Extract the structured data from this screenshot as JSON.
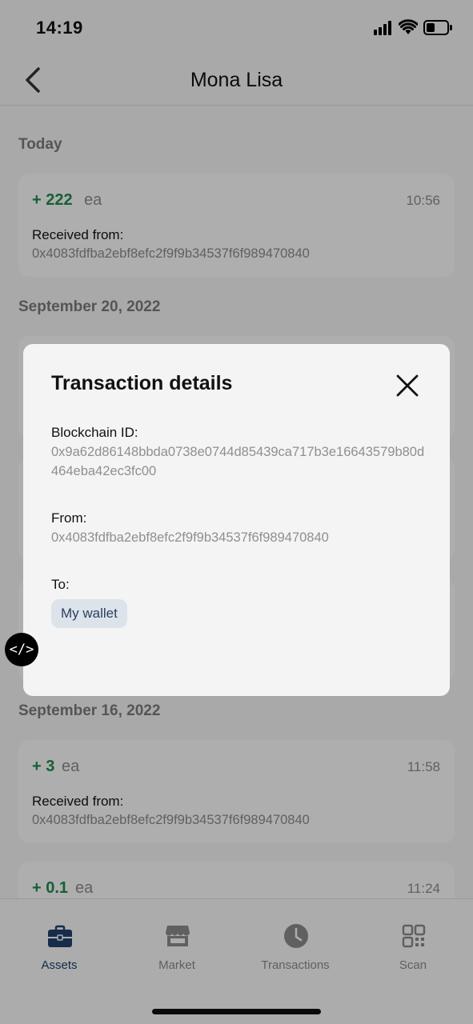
{
  "status_bar": {
    "time": "14:19"
  },
  "header": {
    "title": "Mona Lisa"
  },
  "sections": [
    {
      "title": "Today"
    },
    {
      "title": "September 20, 2022"
    },
    {
      "title": "September 16, 2022"
    }
  ],
  "transactions": [
    {
      "amount": "+ 222",
      "unit": "ea",
      "time": "10:56",
      "label": "Received from:",
      "address": "0x4083fdfba2ebf8efc2f9f9b34537f6f989470840"
    },
    {
      "amount": "+ 3",
      "unit": "ea",
      "time": "11:58",
      "label": "Received from:",
      "address": "0x4083fdfba2ebf8efc2f9f9b34537f6f989470840"
    },
    {
      "amount": "+ 0.1",
      "unit": "ea",
      "time": "11:24"
    }
  ],
  "modal": {
    "title": "Transaction details",
    "blockchain_label": "Blockchain ID:",
    "blockchain_id": "0x9a62d86148bbda0738e0744d85439ca717b3e16643579b80d464eba42ec3fc00",
    "from_label": "From:",
    "from_value": "0x4083fdfba2ebf8efc2f9f9b34537f6f989470840",
    "to_label": "To:",
    "to_value": "My wallet"
  },
  "dev_badge": "</>",
  "bottom_nav": [
    {
      "label": "Assets",
      "icon": "briefcase-icon",
      "active": true
    },
    {
      "label": "Market",
      "icon": "storefront-icon",
      "active": false
    },
    {
      "label": "Transactions",
      "icon": "clock-icon",
      "active": false
    },
    {
      "label": "Scan",
      "icon": "qr-code-icon",
      "active": false
    }
  ],
  "colors": {
    "accent": "#22406b",
    "positive": "#1f8a4c",
    "muted": "#8a8a8a"
  }
}
